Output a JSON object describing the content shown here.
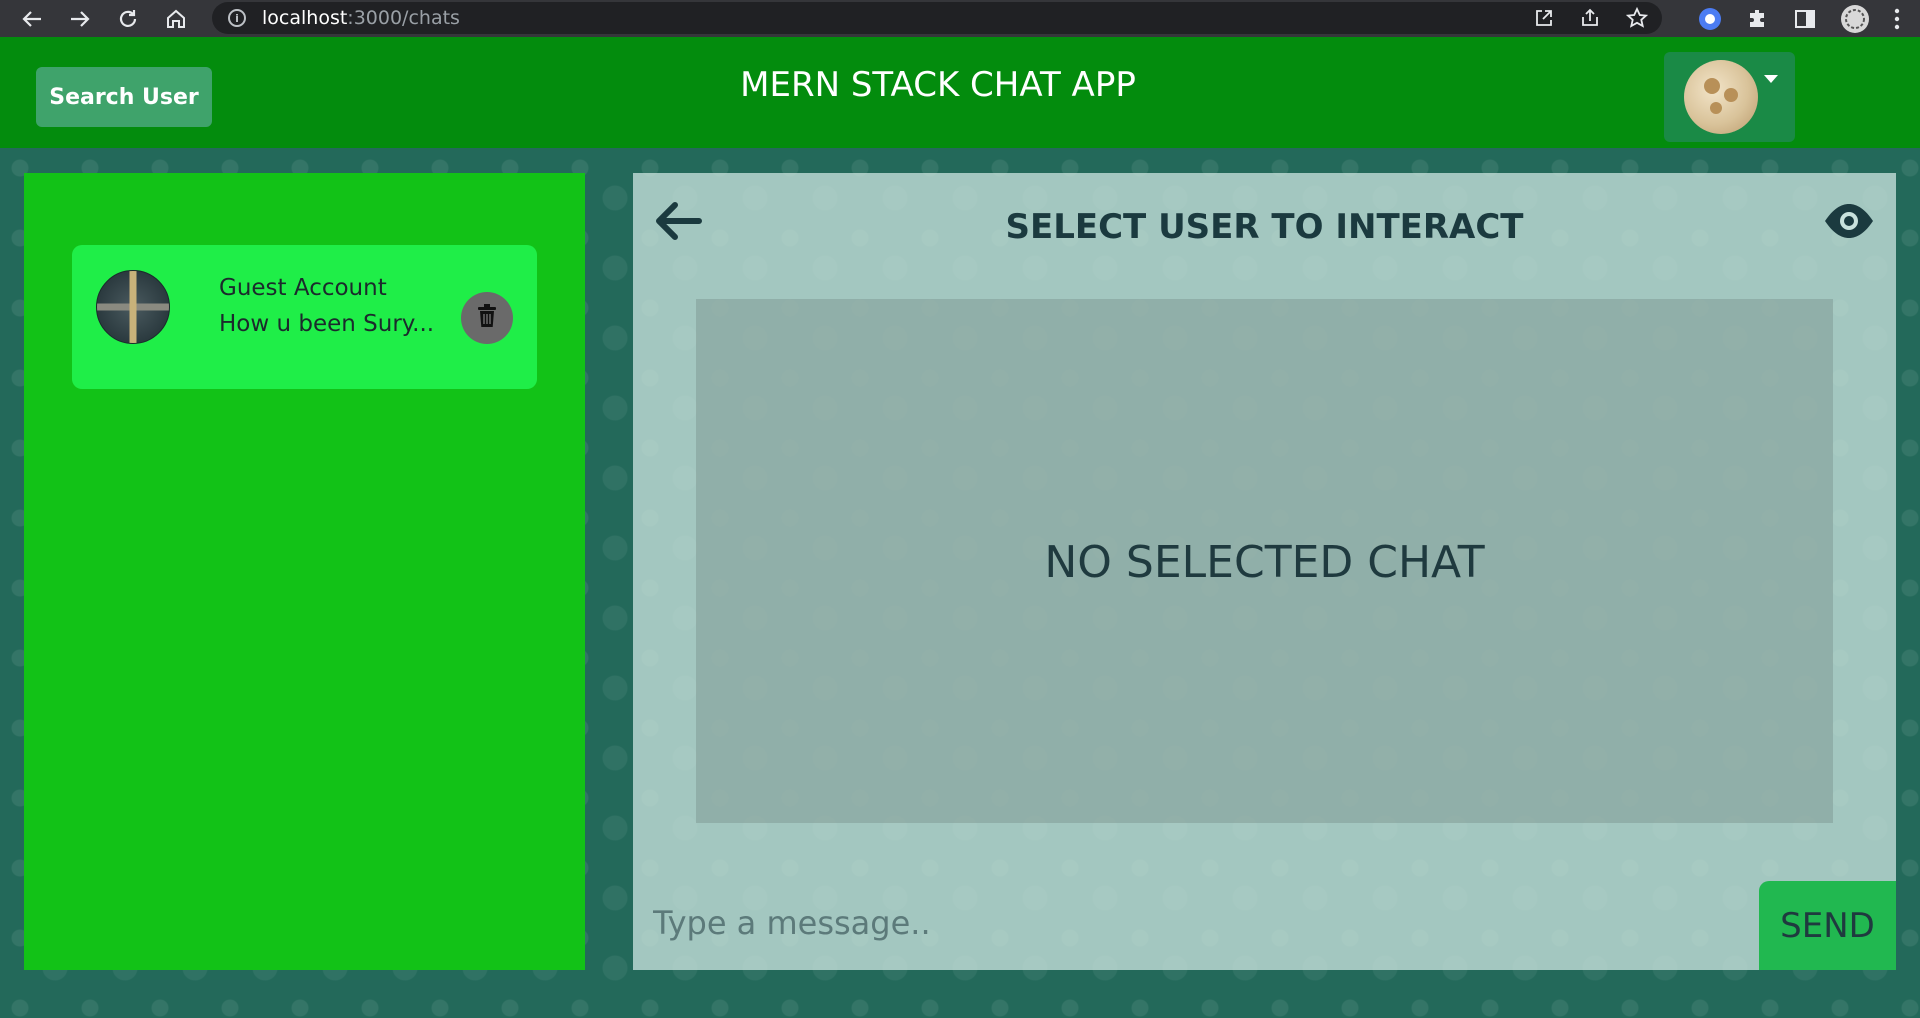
{
  "browser": {
    "url_host": "localhost",
    "url_path": ":3000/chats"
  },
  "header": {
    "search_button_label": "Search User",
    "app_title": "MERN STACK CHAT APP"
  },
  "chat_list": {
    "items": [
      {
        "name": "Guest Account",
        "preview": "How u been Sury..."
      }
    ]
  },
  "chat_panel": {
    "title": "SELECT USER TO INTERACT",
    "empty_state": "NO SELECTED CHAT",
    "message_placeholder": "Type a message..",
    "send_label": "SEND"
  },
  "colors": {
    "header_bg": "#038c0d",
    "chat_list_bg": "#12c217",
    "chat_item_bg": "#1fee48",
    "send_button_bg": "#21b850"
  }
}
